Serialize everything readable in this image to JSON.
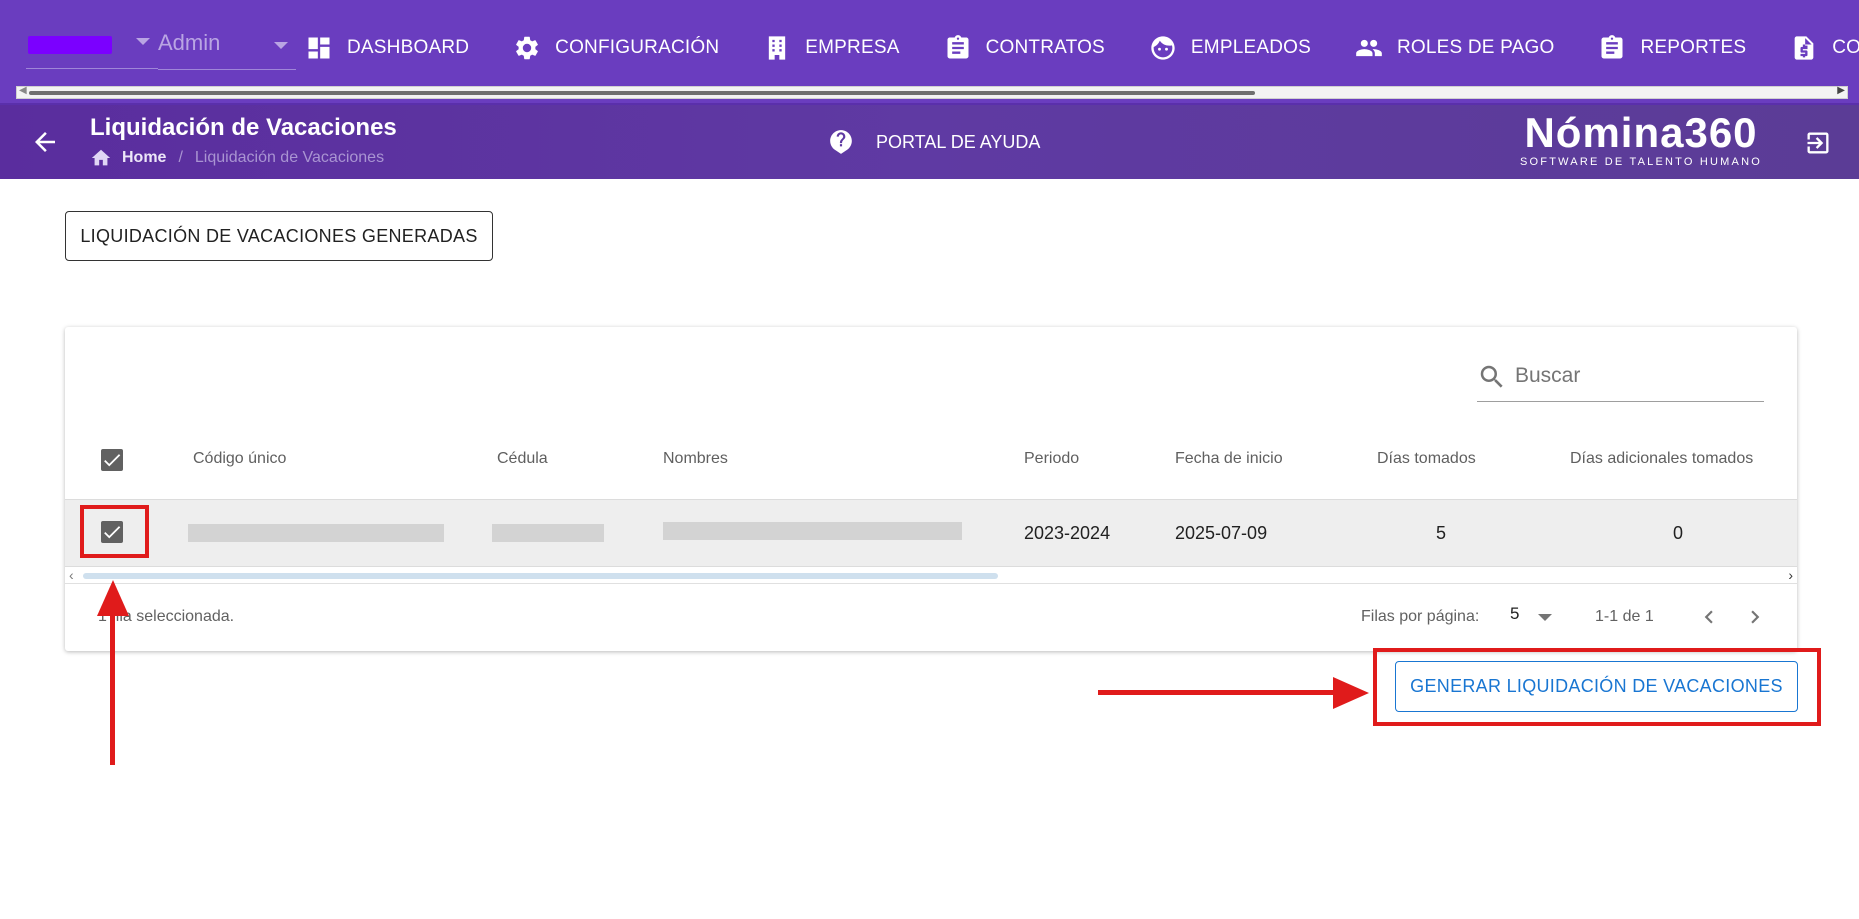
{
  "topbar": {
    "company_selected": "",
    "role_selected": "Admin",
    "nav": [
      {
        "label": "DASHBOARD",
        "icon": "dashboard-icon"
      },
      {
        "label": "CONFIGURACIÓN",
        "icon": "gear-icon"
      },
      {
        "label": "EMPRESA",
        "icon": "building-icon"
      },
      {
        "label": "CONTRATOS",
        "icon": "clipboard-icon"
      },
      {
        "label": "EMPLEADOS",
        "icon": "face-icon"
      },
      {
        "label": "ROLES DE PAGO",
        "icon": "group-icon"
      },
      {
        "label": "REPORTES",
        "icon": "clipboard-list-icon"
      },
      {
        "label": "COSTOS",
        "icon": "dollar-file-icon"
      }
    ]
  },
  "subheader": {
    "title": "Liquidación de Vacaciones",
    "breadcrumb_home": "Home",
    "breadcrumb_separator": "/",
    "breadcrumb_current": "Liquidación de Vacaciones",
    "help_label": "PORTAL DE AYUDA",
    "brand_name": "Nómina360",
    "brand_tagline": "SOFTWARE DE TALENTO HUMANO"
  },
  "actions": {
    "generated_label": "LIQUIDACIÓN DE VACACIONES GENERADAS",
    "generate_label": "GENERAR LIQUIDACIÓN DE VACACIONES"
  },
  "table": {
    "search_placeholder": "Buscar",
    "columns": [
      "Código único",
      "Cédula",
      "Nombres",
      "Periodo",
      "Fecha de inicio",
      "Días tomados",
      "Días adicionales tomados"
    ],
    "rows": [
      {
        "codigo": "",
        "cedula": "",
        "nombres": "",
        "periodo": "2023-2024",
        "fecha_inicio": "2025-07-09",
        "dias_tomados": "5",
        "dias_adicionales": "0",
        "selected": true
      }
    ],
    "selection_text": "1 fila seleccionada.",
    "rows_per_page_label": "Filas por página:",
    "rows_per_page": "5",
    "page_range": "1-1 de 1"
  },
  "colors": {
    "topbar": "#6a3dbf",
    "subheader": "#5a2d9e",
    "primary": "#1976d2",
    "annotation": "#e01b1b"
  }
}
